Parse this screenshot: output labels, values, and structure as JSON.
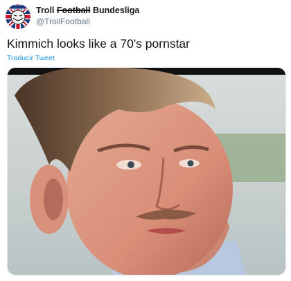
{
  "tweet": {
    "author": {
      "name_first": "Troll",
      "name_strike": "Football",
      "name_last": "Bundesliga",
      "handle": "@TrollFootball",
      "avatar_icon": "troll-face-union-jack-icon"
    },
    "text": "Kimmich looks like a 70's pornstar",
    "translate_label": "Traducir Tweet",
    "media": {
      "icon": "player-portrait-image"
    }
  },
  "colors": {
    "text": "#14171a",
    "secondary": "#657786",
    "link": "#1b95e0"
  }
}
